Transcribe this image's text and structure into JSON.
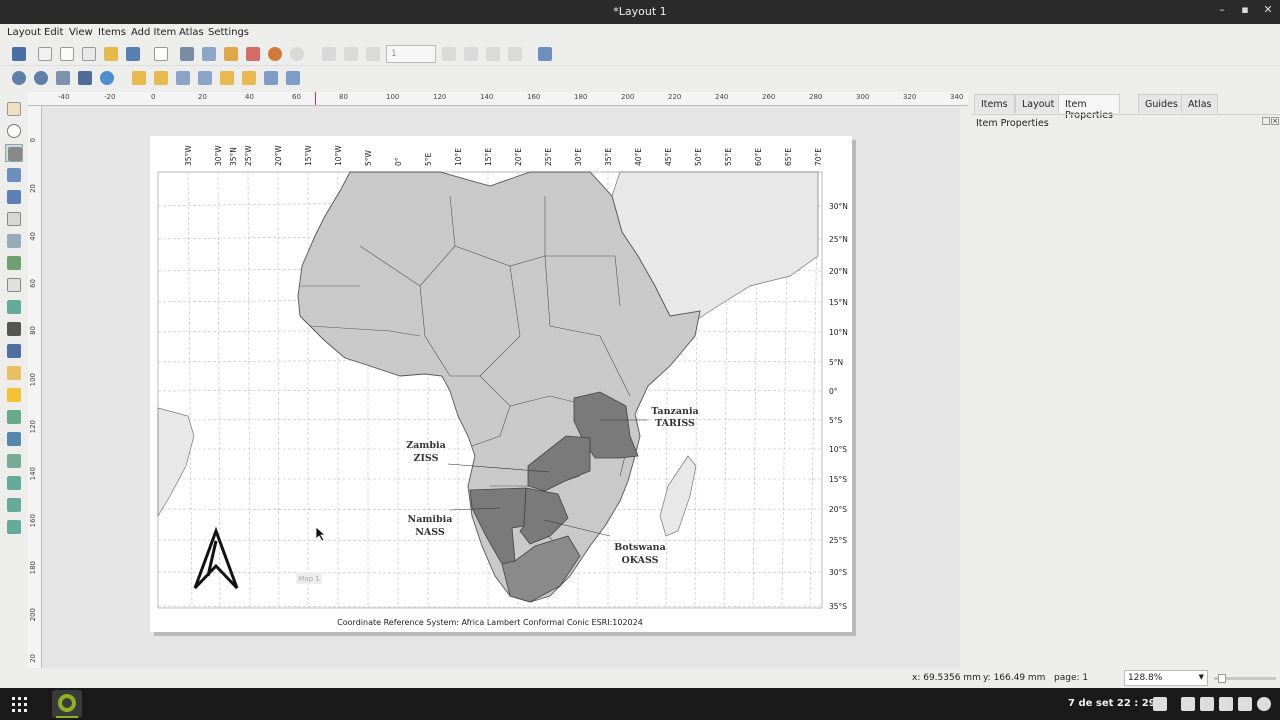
{
  "window": {
    "title": "*Layout 1",
    "minimize": "–",
    "maximize": "▪",
    "close": "✕"
  },
  "menu": [
    "Layout",
    "Edit",
    "View",
    "Items",
    "Add Item",
    "Atlas",
    "Settings"
  ],
  "toolbar": {
    "page_value": "1"
  },
  "ruler_h": [
    "-40",
    "-20",
    "0",
    "20",
    "40",
    "60",
    "80",
    "100",
    "120",
    "140",
    "160",
    "180",
    "200",
    "220",
    "240",
    "260",
    "280",
    "300",
    "320",
    "340"
  ],
  "ruler_v": [
    "0",
    "20",
    "40",
    "60",
    "80",
    "100",
    "120",
    "140",
    "160",
    "180",
    "200",
    "20"
  ],
  "map": {
    "lon_labels": [
      "35°W",
      "30°W",
      "35°N",
      "25°W",
      "20°W",
      "15°W",
      "10°W",
      "5°W",
      "0°",
      "5°E",
      "10°E",
      "15°E",
      "20°E",
      "25°E",
      "30°E",
      "35°E",
      "40°E",
      "45°E",
      "50°E",
      "55°E",
      "60°E",
      "65°E",
      "70°E"
    ],
    "lat_labels": [
      "30°N",
      "25°N",
      "20°N",
      "15°N",
      "10°N",
      "5°N",
      "0°",
      "5°S",
      "10°S",
      "15°S",
      "20°S",
      "25°S",
      "30°S",
      "35°S"
    ],
    "labels": [
      {
        "country": "Tanzania",
        "code": "TARISS"
      },
      {
        "country": "Zambia",
        "code": "ZISS"
      },
      {
        "country": "Namibia",
        "code": "NASS"
      },
      {
        "country": "Botswana",
        "code": "OKASS"
      }
    ],
    "crs_caption": "Coordinate Reference System: Africa Lambert Conformal Conic ESRI:102024",
    "scalebar_label": "Map 1",
    "colors": {
      "land": "#c9c9c9",
      "highlight": "#777777",
      "other_land": "#e6e6e6",
      "grid": "#bdbdbd"
    }
  },
  "panel": {
    "tabs": [
      "Items",
      "Layout",
      "Item Properties",
      "Guides",
      "Atlas"
    ],
    "active_tab": "Item Properties",
    "header": "Item Properties"
  },
  "status": {
    "x": "x: 69.5356 mm",
    "y": "y: 166.49 mm",
    "page": "page: 1",
    "zoom": "128.8%"
  },
  "taskbar": {
    "clock": "7 de set  22 : 29"
  }
}
